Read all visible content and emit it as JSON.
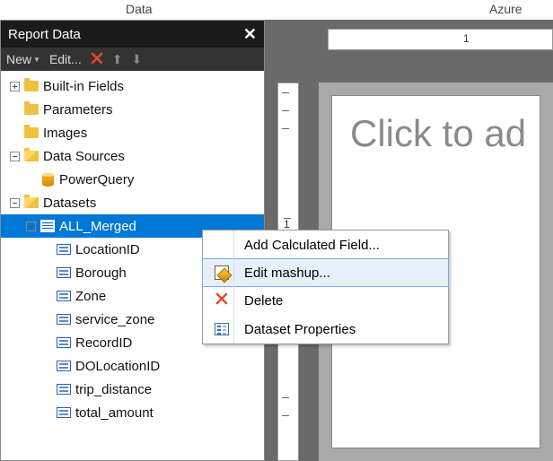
{
  "top_menu": {
    "item1": "Data",
    "item2": "Azure"
  },
  "panel": {
    "title": "Report Data",
    "toolbar": {
      "new": "New",
      "edit": "Edit..."
    }
  },
  "tree": {
    "builtin": "Built-in Fields",
    "parameters": "Parameters",
    "images": "Images",
    "data_sources": "Data Sources",
    "powerquery": "PowerQuery",
    "datasets": "Datasets",
    "all_merged": "ALL_Merged",
    "fields": {
      "f0": "LocationID",
      "f1": "Borough",
      "f2": "Zone",
      "f3": "service_zone",
      "f4": "RecordID",
      "f5": "DOLocationID",
      "f6": "trip_distance",
      "f7": "total_amount"
    }
  },
  "context_menu": {
    "add_calc": "Add Calculated Field...",
    "edit_mashup": "Edit mashup...",
    "delete": "Delete",
    "props": "Dataset Properties"
  },
  "ruler": {
    "one": "1",
    "v_one": "1"
  },
  "canvas": {
    "placeholder": "Click to ad"
  }
}
